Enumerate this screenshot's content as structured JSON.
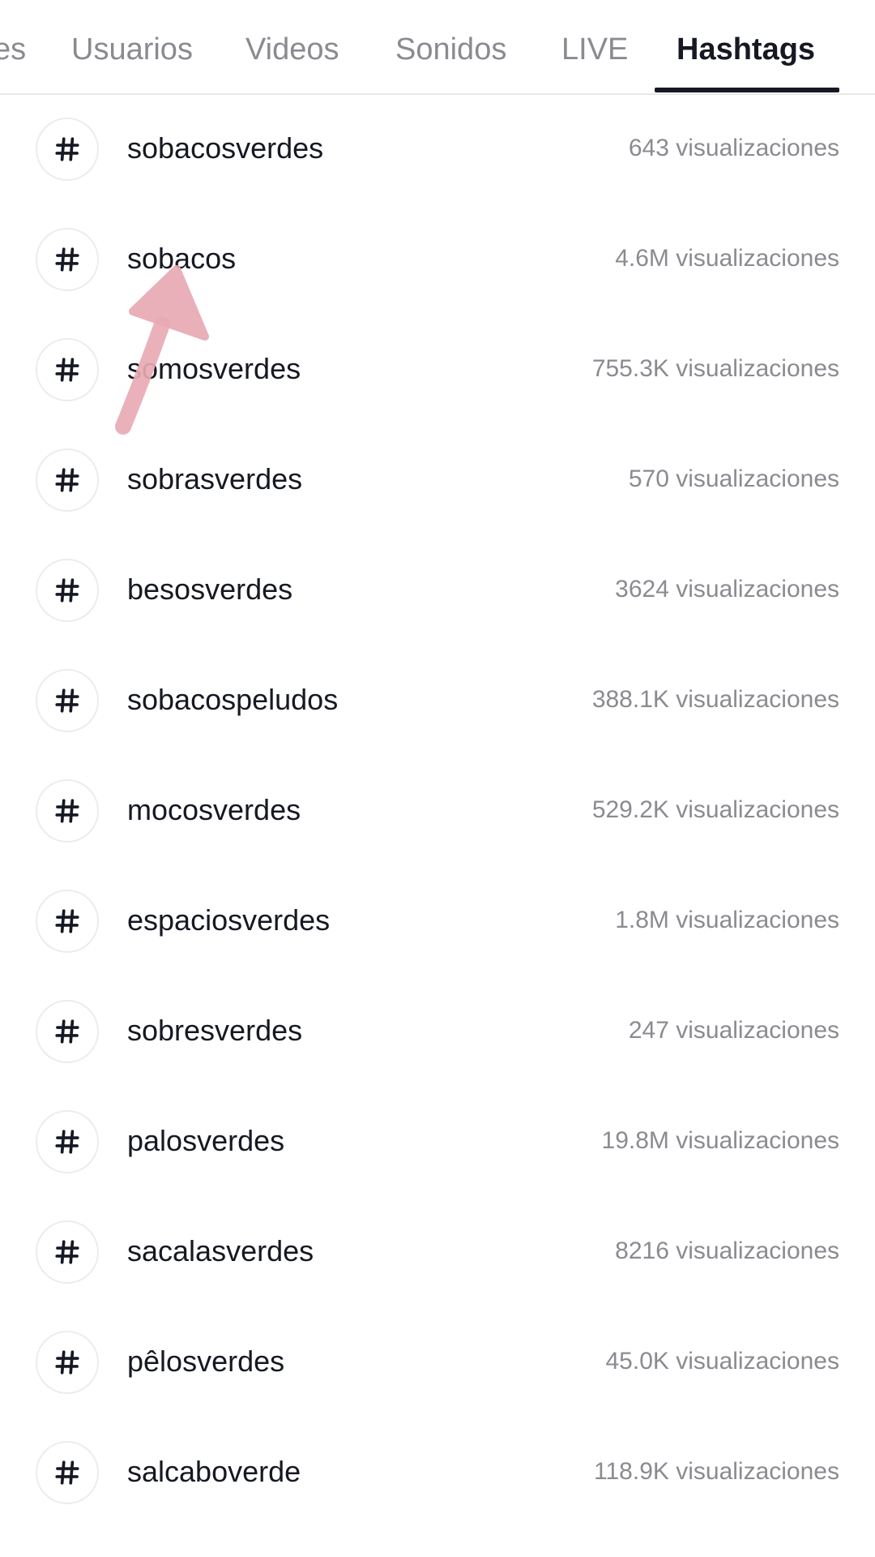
{
  "tabs": [
    {
      "label": "es",
      "active": false
    },
    {
      "label": "Usuarios",
      "active": false
    },
    {
      "label": "Videos",
      "active": false
    },
    {
      "label": "Sonidos",
      "active": false
    },
    {
      "label": "LIVE",
      "active": false
    },
    {
      "label": "Hashtags",
      "active": true
    }
  ],
  "hashtags": [
    {
      "name": "sobacosverdes",
      "views": "643 visualizaciones"
    },
    {
      "name": "sobacos",
      "views": "4.6M visualizaciones"
    },
    {
      "name": "somosverdes",
      "views": "755.3K visualizaciones"
    },
    {
      "name": "sobrasverdes",
      "views": "570 visualizaciones"
    },
    {
      "name": "besosverdes",
      "views": "3624 visualizaciones"
    },
    {
      "name": "sobacospeludos",
      "views": "388.1K visualizaciones"
    },
    {
      "name": "mocosverdes",
      "views": "529.2K visualizaciones"
    },
    {
      "name": "espaciosverdes",
      "views": "1.8M visualizaciones"
    },
    {
      "name": "sobresverdes",
      "views": "247 visualizaciones"
    },
    {
      "name": "palosverdes",
      "views": "19.8M visualizaciones"
    },
    {
      "name": "sacalasverdes",
      "views": "8216 visualizaciones"
    },
    {
      "name": "pêlosverdes",
      "views": "45.0K visualizaciones"
    },
    {
      "name": "salcaboverde",
      "views": "118.9K visualizaciones"
    }
  ],
  "icons": {
    "hashtag": "hash-icon",
    "pointer": "arrow-icon"
  },
  "colors": {
    "text_primary": "#161823",
    "text_secondary": "#8a8b91",
    "arrow": "#e8aab4"
  }
}
